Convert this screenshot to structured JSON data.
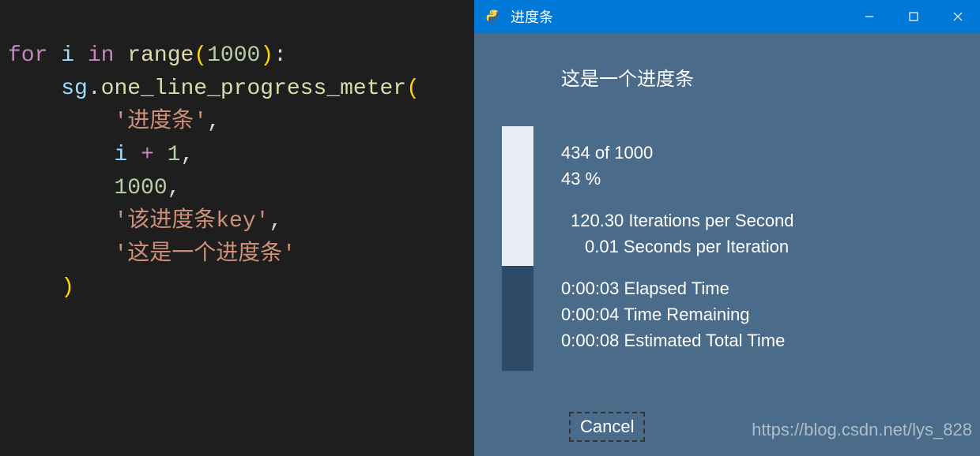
{
  "code": {
    "kw_for": "for",
    "var_i": "i",
    "kw_in": "in",
    "func_range": "range",
    "range_arg": "1000",
    "obj_sg": "sg",
    "method": "one_line_progress_meter",
    "arg1": "'进度条'",
    "arg2_var": "i",
    "arg2_op": "+",
    "arg2_num": "1",
    "arg3": "1000",
    "arg4": "'该进度条key'",
    "arg5": "'这是一个进度条'"
  },
  "window": {
    "title": "进度条",
    "heading": "这是一个进度条",
    "progress": {
      "count_text": "434 of 1000",
      "percent_text": "43 %",
      "percent_value": 43,
      "ips": "120.30 Iterations per Second",
      "spi": "0.01 Seconds per Iteration",
      "elapsed": "0:00:03 Elapsed Time",
      "remaining": "0:00:04 Time Remaining",
      "total": "0:00:08 Estimated Total Time"
    },
    "cancel_label": "Cancel",
    "watermark": "https://blog.csdn.net/lys_828"
  }
}
